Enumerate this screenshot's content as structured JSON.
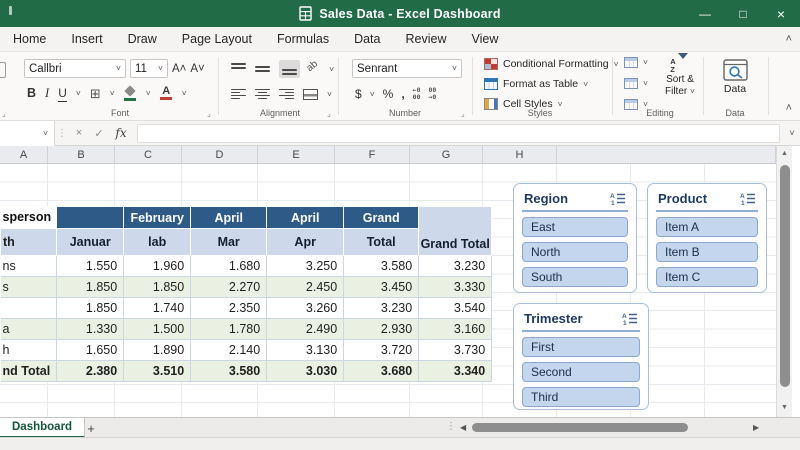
{
  "window": {
    "title": "Sales Data - Excel Dashboard"
  },
  "icons": {
    "minimize": "—",
    "maximize": "□",
    "close": "×",
    "chevron_down": "˅",
    "collapse_ribbon": "˄",
    "cancel": "×",
    "enter": "✓",
    "fx": "fx",
    "scroll_up": "▲",
    "scroll_down": "▼",
    "scroll_left": "◀",
    "scroll_right": "▶",
    "divider_dots": "⋮",
    "add_sheet": "+"
  },
  "ribbon_tabs": [
    "Home",
    "Insert",
    "Draw",
    "Page Layout",
    "Formulas",
    "Data",
    "Review",
    "View"
  ],
  "font_group": {
    "label": "Font",
    "font_name": "Callbri",
    "font_size": "11",
    "increase": "A˄",
    "decrease": "A˅",
    "bold": "B",
    "italic": "I",
    "underline": "U"
  },
  "alignment_group": {
    "label": "Alignment",
    "orientation": "ab"
  },
  "number_group": {
    "label": "Number",
    "format": "Senrant",
    "currency": "$",
    "percent": "%",
    "comma": ",",
    "inc_top": "←0",
    "inc_bottom": "00",
    "dec_top": "00",
    "dec_bottom": "→0"
  },
  "styles_group": {
    "label": "Styles",
    "conditional_formatting": "Conditional Formatting",
    "format_as_table": "Format as Table",
    "cell_styles": "Cell Styles"
  },
  "editing_group": {
    "label": "Editing",
    "az_a": "A",
    "az_z": "Z",
    "sort_line1": "Sort &",
    "sort_line2": "Filter"
  },
  "data_group": {
    "label": "Data",
    "button_label": "Data"
  },
  "formula_bar": {
    "value": ""
  },
  "sheet": {
    "columns": [
      "A",
      "B",
      "C",
      "D",
      "E",
      "F",
      "G",
      "H"
    ]
  },
  "pivot": {
    "corner_row1": "sperson",
    "corner_row2": "th",
    "header_row1": [
      "",
      "February",
      "April",
      "April",
      "Grand"
    ],
    "header_row2": [
      "Januar",
      "lab",
      "Mar",
      "Apr",
      "Total"
    ],
    "grand_total_col": "Grand Total",
    "rows": [
      {
        "label": "ns",
        "values": [
          "1.550",
          "1.960",
          "1.680",
          "3.250",
          "3.580",
          "3.230"
        ]
      },
      {
        "label": "s",
        "values": [
          "1.850",
          "1.850",
          "2.270",
          "2.450",
          "3.450",
          "3.330"
        ]
      },
      {
        "label": "",
        "values": [
          "1.850",
          "1.740",
          "2.350",
          "3.260",
          "3.230",
          "3.540"
        ]
      },
      {
        "label": "a",
        "values": [
          "1.330",
          "1.500",
          "1.780",
          "2.490",
          "2.930",
          "3.160"
        ]
      },
      {
        "label": "h",
        "values": [
          "1.650",
          "1.890",
          "2.140",
          "3.130",
          "3.720",
          "3.730"
        ]
      },
      {
        "label": "nd Total",
        "values": [
          "2.380",
          "3.510",
          "3.580",
          "3.030",
          "3.680",
          "3.340"
        ]
      }
    ]
  },
  "slicers": [
    {
      "title": "Region",
      "items": [
        "East",
        "North",
        "South"
      ]
    },
    {
      "title": "Product",
      "items": [
        "Item A",
        "Item B",
        "Item C"
      ]
    },
    {
      "title": "Trimester",
      "items": [
        "First",
        "Second",
        "Third"
      ]
    }
  ],
  "sheet_bar": {
    "active_tab": "Dashboard"
  },
  "colors": {
    "titlebar_green": "#216C47",
    "accent_green": "#1E6B47",
    "pivot_header_blue": "#2D5A87",
    "pivot_light_blue": "#CDD9EB",
    "band_green": "#EAF1E2",
    "slicer_item_blue": "#C3D6EE",
    "slicer_border": "#A9BFDB"
  }
}
